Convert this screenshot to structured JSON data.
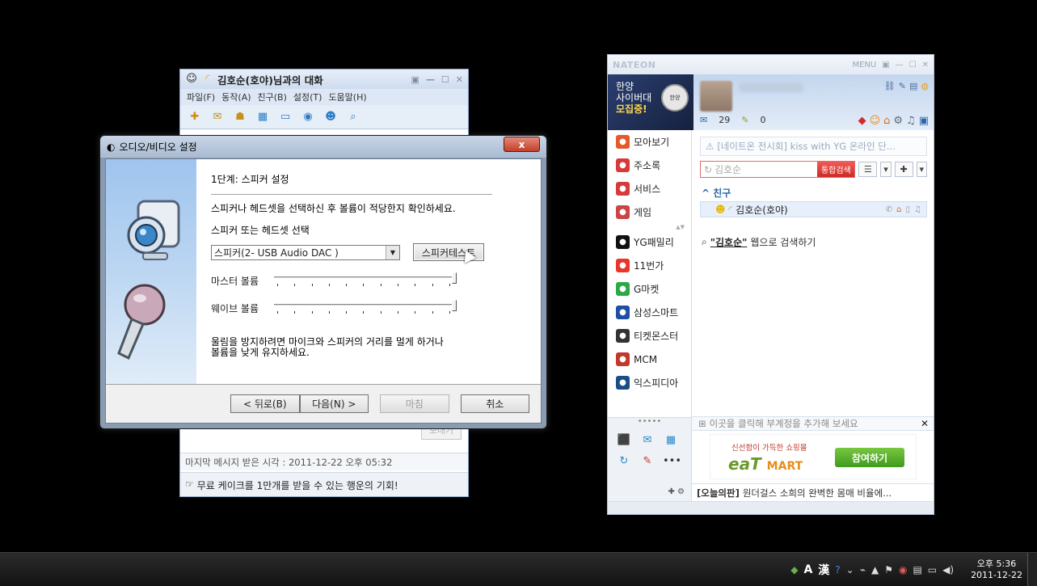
{
  "chat_window": {
    "title": "김호순(호야)님과의 대화",
    "menu": [
      "파일(F)",
      "동작(A)",
      "친구(B)",
      "설정(T)",
      "도움말(H)"
    ],
    "send_label": "보내기",
    "last_message": "마지막 메시지 받은 시각 : 2011-12-22 오후 05:32",
    "ad_text": "무료 케이크를 1만개를 받을 수 있는 행운의 기회!"
  },
  "dialog": {
    "title": "오디오/비디오 설정",
    "step_title": "1단계: 스피커 설정",
    "description": "스피커나 헤드셋을 선택하신 후 볼륨이 적당한지 확인하세요.",
    "device_label": "스피커 또는 헤드셋 선택",
    "device_value": "스피커(2- USB Audio DAC   )",
    "test_button": "스피커테스트",
    "master_volume_label": "마스터 볼륨",
    "master_volume_level": 1.0,
    "wave_volume_label": "웨이브 볼륨",
    "wave_volume_level": 1.0,
    "hint_line1": "울림을 방지하려면 마이크와 스피커의 거리를 멀게 하거나",
    "hint_line2": "볼륨을 낮게 유지하세요.",
    "back_button": "< 뒤로(B)",
    "next_button": "다음(N) >",
    "finish_button": "마침",
    "cancel_button": "취소",
    "close_label": "x"
  },
  "nateon": {
    "logo": "NATEON",
    "menu_label": "MENU",
    "ad_line1": "한양",
    "ad_line2": "사이버대",
    "ad_line3": "모집중!",
    "seal_text": "한양",
    "mail_count": "29",
    "memo_count": "0",
    "sidebar": [
      {
        "label": "모아보기",
        "icon": "collect-icon",
        "color": "#e35a2b"
      },
      {
        "label": "주소록",
        "icon": "address-book-icon",
        "color": "#d73a3a"
      },
      {
        "label": "서비스",
        "icon": "service-icon",
        "color": "#d73a3a"
      },
      {
        "label": "게임",
        "icon": "game-icon",
        "color": "#cc4545"
      },
      {
        "label": "YG패밀리",
        "icon": "yg-icon",
        "color": "#111111"
      },
      {
        "label": "11번가",
        "icon": "11st-icon",
        "color": "#e8362b"
      },
      {
        "label": "G마켓",
        "icon": "gmarket-icon",
        "color": "#2aa944"
      },
      {
        "label": "삼성스마트",
        "icon": "samsung-icon",
        "color": "#1e4fa3"
      },
      {
        "label": "티켓몬스터",
        "icon": "tmon-icon",
        "color": "#333333"
      },
      {
        "label": "MCM",
        "icon": "mcm-icon",
        "color": "#c0392b"
      },
      {
        "label": "익스피디아",
        "icon": "expedia-icon",
        "color": "#1b4e86"
      }
    ],
    "notice": "[네이트온 전시회] kiss with YG 온라인 단...",
    "search_placeholder": "김호순",
    "search_button": "통합검색",
    "group_name": "친구",
    "buddy_name": "김호순(호야)",
    "web_search_query": "\"김호순\"",
    "web_search_suffix": "웹으로 검색하기",
    "sub_account_text": "이곳을 클릭해 부계정을 추가해 보세요",
    "eat_tagline": "신선함이 가득한 쇼핑몰",
    "eat_logo": "eaT",
    "eat_logo_mart": "MART",
    "eat_button": "참여하기",
    "today_label": "[오늘의판]",
    "today_text": "원더걸스 소희의 완벽한 몸매 비율에..."
  },
  "taskbar": {
    "ime_a": "A",
    "ime_han": "漢",
    "time": "오후 5:36",
    "date": "2011-12-22"
  }
}
